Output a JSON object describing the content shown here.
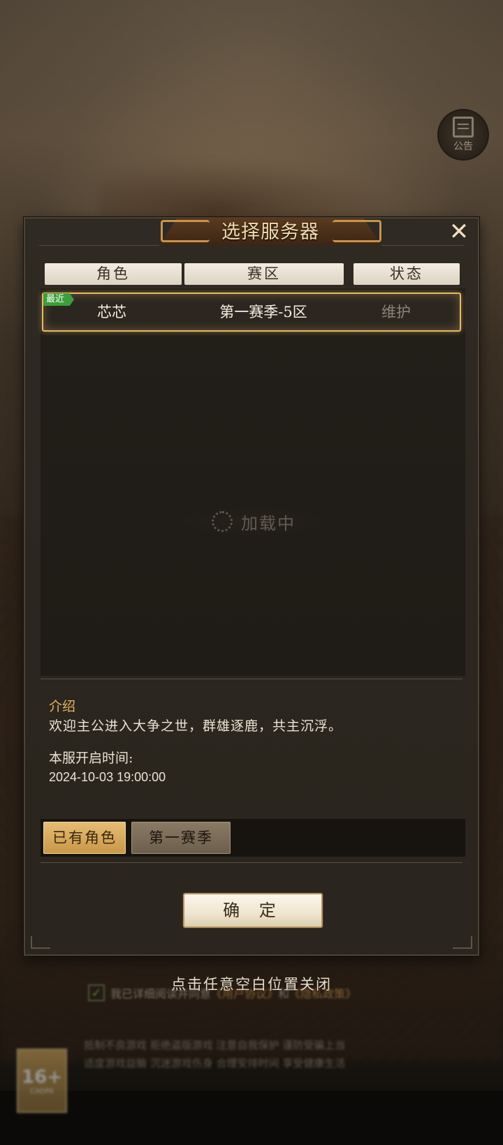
{
  "notice": {
    "label": "公告",
    "icon": "notice-icon"
  },
  "dialog": {
    "title": "选择服务器",
    "close_icon": "close-icon",
    "table_headers": [
      "角色",
      "赛区",
      "状态"
    ],
    "servers": [
      {
        "tag": "最近",
        "role": "芯芯",
        "zone": "第一赛季-5区",
        "status": "维护",
        "highlighted": true
      }
    ],
    "loading_text": "加载中",
    "intro_label": "介绍",
    "intro_text": "欢迎主公进入大争之世，群雄逐鹿，共主沉浮。",
    "open_time_label": "本服开启时间:",
    "open_time": "2024-10-03 19:00:00",
    "filters": [
      {
        "label": "已有角色",
        "active": true
      },
      {
        "label": "第一赛季",
        "active": false
      }
    ],
    "confirm_label": "确 定"
  },
  "tap_to_close": "点击任意空白位置关闭",
  "agreement": {
    "prefix": "我已详细阅读并同意",
    "link1": "《用户协议》",
    "mid": "和",
    "link2": "《隐私政策》"
  },
  "health_notice": {
    "line1": "抵制不良游戏 拒绝盗版游戏 注意自我保护 谨防受骗上当",
    "line2": "适度游戏益脑 沉迷游戏伤身 合理安排时间 享受健康生活"
  },
  "age_rating": {
    "value": "16+",
    "label": "CADPA"
  },
  "colors": {
    "accent_gold": "#e6b45c",
    "recent_tag": "#3c9e3a",
    "status_gray": "#8c8579"
  }
}
